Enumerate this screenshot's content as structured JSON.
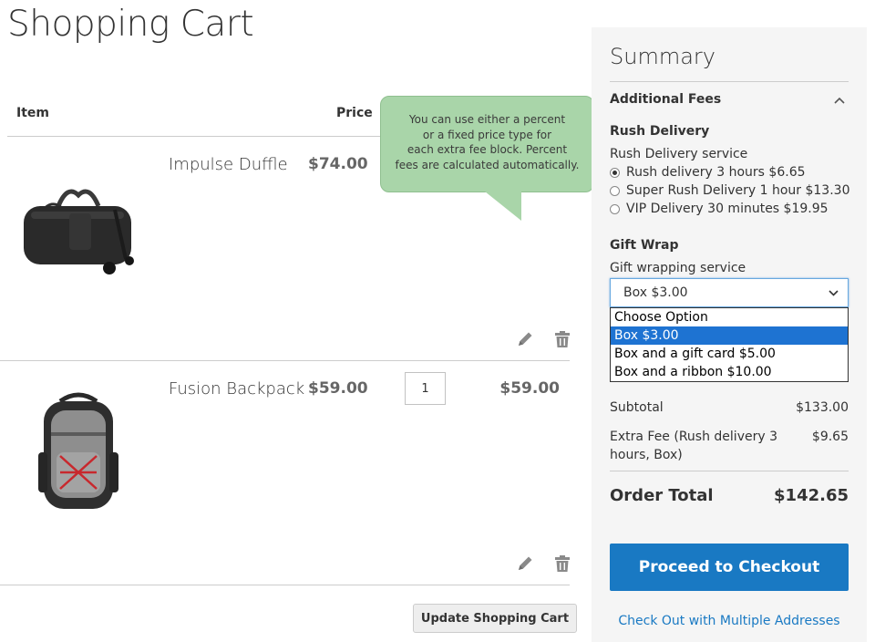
{
  "page": {
    "title": "Shopping Cart"
  },
  "cart": {
    "columns": {
      "item": "Item",
      "price": "Price"
    },
    "items": [
      {
        "name": "Impulse Duffle",
        "price": "$74.00",
        "image_icon": "duffle-bag-image"
      },
      {
        "name": "Fusion Backpack",
        "price": "$59.00",
        "qty": "1",
        "subtotal": "$59.00",
        "image_icon": "backpack-image"
      }
    ],
    "update_button": "Update Shopping Cart"
  },
  "tooltip": {
    "lines": [
      "You can use either a percent",
      "or a fixed price type for",
      "each extra fee block. Percent",
      "fees are calculated automatically."
    ],
    "color": "#a9d5a9"
  },
  "summary": {
    "title": "Summary",
    "additional_fees": "Additional Fees",
    "rush": {
      "title": "Rush Delivery",
      "subtitle": "Rush Delivery service",
      "options": [
        {
          "label": "Rush delivery 3 hours $6.65",
          "checked": true
        },
        {
          "label": "Super Rush Delivery 1 hour $13.30",
          "checked": false
        },
        {
          "label": "VIP Delivery 30 minutes $19.95",
          "checked": false
        }
      ]
    },
    "gift": {
      "title": "Gift Wrap",
      "subtitle": "Gift wrapping service",
      "selected": "Box $3.00",
      "options": [
        "Choose Option",
        "Box $3.00",
        "Box and a gift card $5.00",
        "Box and a ribbon $10.00"
      ]
    },
    "totals": {
      "subtotal_label": "Subtotal",
      "subtotal_value": "$133.00",
      "fee_label_line1": "Extra Fee (Rush delivery 3",
      "fee_label_line2": "hours, Box)",
      "fee_value": "$9.65",
      "order_total_label": "Order Total",
      "order_total_value": "$142.65"
    },
    "checkout_button": "Proceed to Checkout",
    "multi_address_link": "Check Out with Multiple Addresses"
  },
  "colors": {
    "accent": "#1979c3",
    "selected_option": "#1e73d2",
    "summary_bg": "#f5f5f5"
  }
}
